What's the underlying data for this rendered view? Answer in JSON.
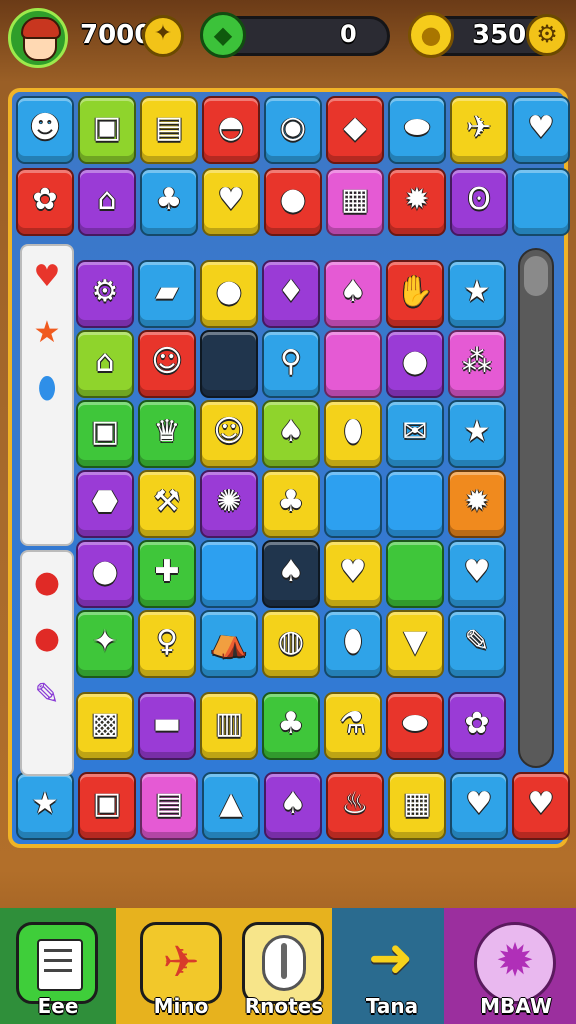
{
  "hud": {
    "score": "7000",
    "counter": "0",
    "coins": "350"
  },
  "colors": {
    "green": "#3fc63a",
    "lime": "#8fd42c",
    "yellow": "#f4d21a",
    "red": "#e8352b",
    "blue": "#2fa3e8",
    "purple": "#9a3bd6",
    "pink": "#e55ad4",
    "orange": "#f08a1e",
    "dark": "#20354d",
    "sky": "#2da0f0"
  },
  "board": {
    "rows": [
      [
        [
          "blue",
          "☻",
          "blob-creature-icon"
        ],
        [
          "lime",
          "▣",
          "monitor-icon"
        ],
        [
          "yellow",
          "▤",
          "jar-icon"
        ],
        [
          "red",
          "◓",
          "shell-icon"
        ],
        [
          "blue",
          "◉",
          "ring-icon"
        ],
        [
          "red",
          "◆",
          "leaf-icon"
        ],
        [
          "blue",
          "⬬",
          "capsule-icon"
        ],
        [
          "yellow",
          "✈",
          "plane-icon"
        ],
        [
          "blue",
          "♥",
          "heart-icon"
        ]
      ],
      [
        [
          "red",
          "✿",
          "flower-icon"
        ],
        [
          "purple",
          "⌂",
          "house-icon"
        ],
        [
          "blue",
          "♣",
          "tree-icon"
        ],
        [
          "yellow",
          "♥",
          "heart-icon"
        ],
        [
          "red",
          "●",
          "blob-icon"
        ],
        [
          "pink",
          "▦",
          "box-icon"
        ],
        [
          "red",
          "✹",
          "sun-icon"
        ],
        [
          "purple",
          "ʘ",
          "bear-face-icon"
        ],
        [
          "blue",
          "",
          "empty-tile"
        ]
      ]
    ]
  },
  "grid": [
    [
      [
        "purple",
        "⚙",
        "robot-icon"
      ],
      [
        "blue",
        "▰",
        "capsule-icon"
      ],
      [
        "yellow",
        "●",
        "bomb-icon"
      ],
      [
        "purple",
        "♦",
        "fruit-icon"
      ],
      [
        "pink",
        "♠",
        "strawberry-icon"
      ],
      [
        "red",
        "✋",
        "glove-icon"
      ],
      [
        "blue",
        "★",
        "star-icon"
      ]
    ],
    [
      [
        "lime",
        "⌂",
        "lamp-icon"
      ],
      [
        "red",
        "☺",
        "smiley-icon"
      ],
      [
        "dark",
        "",
        "empty-tile"
      ],
      [
        "blue",
        "⚲",
        "ring-icon"
      ],
      [
        "pink",
        "",
        "empty-tile"
      ],
      [
        "purple",
        "●",
        "plum-icon"
      ],
      [
        "pink",
        "⁂",
        "dots-icon"
      ]
    ],
    [
      [
        "green",
        "▣",
        "card-icon"
      ],
      [
        "green",
        "♛",
        "crown-icon"
      ],
      [
        "yellow",
        "☺",
        "cheese-icon"
      ],
      [
        "lime",
        "♠",
        "pepper-icon"
      ],
      [
        "yellow",
        "⬮",
        "lemon-icon"
      ],
      [
        "blue",
        "✉",
        "scroll-icon"
      ],
      [
        "blue",
        "★",
        "red-star-icon"
      ]
    ],
    [
      [
        "purple",
        "⬣",
        "shield-icon"
      ],
      [
        "yellow",
        "⚒",
        "hammer-icon"
      ],
      [
        "purple",
        "✺",
        "rock-icon"
      ],
      [
        "yellow",
        "♣",
        "berry-icon"
      ],
      [
        "sky",
        "",
        "empty-tile"
      ],
      [
        "sky",
        "",
        "empty-tile"
      ],
      [
        "orange",
        "✹",
        "sun-icon"
      ]
    ],
    [
      [
        "purple",
        "●",
        "lemon-icon"
      ],
      [
        "green",
        "✚",
        "plus-icon"
      ],
      [
        "sky",
        "",
        "empty-tile"
      ],
      [
        "dark",
        "♠",
        "fish-icon"
      ],
      [
        "yellow",
        "♥",
        "apple-icon"
      ],
      [
        "green",
        "",
        "empty-tile"
      ],
      [
        "blue",
        "♥",
        "heart-icon"
      ]
    ],
    [
      [
        "green",
        "✦",
        "fox-icon"
      ],
      [
        "yellow",
        "♀",
        "key-icon"
      ],
      [
        "blue",
        "⛺",
        "tent-icon"
      ],
      [
        "yellow",
        "◍",
        "pumpkin-icon"
      ],
      [
        "blue",
        "⬮",
        "pear-icon"
      ],
      [
        "yellow",
        "▼",
        "gem-icon"
      ],
      [
        "blue",
        "✎",
        "brush-icon"
      ]
    ]
  ],
  "bottomgrid": [
    [
      [
        "yellow",
        "▩",
        "cube-icon"
      ],
      [
        "purple",
        "▬",
        "bar-icon"
      ],
      [
        "yellow",
        "▥",
        "basket-icon"
      ],
      [
        "green",
        "♣",
        "leaf-icon"
      ],
      [
        "yellow",
        "⚗",
        "robot-icon"
      ],
      [
        "red",
        "⬬",
        "capsule-icon"
      ],
      [
        "purple",
        "✿",
        "flower-icon"
      ]
    ],
    [
      [
        "blue",
        "★",
        "star-icon"
      ],
      [
        "red",
        "▣",
        "sign-icon"
      ],
      [
        "pink",
        "▤",
        "card-icon"
      ],
      [
        "blue",
        "▲",
        "lamp-icon"
      ],
      [
        "purple",
        "♠",
        "fruit-icon"
      ],
      [
        "red",
        "♨",
        "fire-icon"
      ],
      [
        "yellow",
        "▦",
        "box-icon"
      ],
      [
        "blue",
        "♥",
        "apple-icon"
      ],
      [
        "red",
        "♥",
        "heart-icon"
      ]
    ]
  ],
  "side_top": [
    "♥",
    "★",
    "⬮"
  ],
  "side_bottom": [
    "●",
    "●",
    "✎"
  ],
  "bottom": {
    "b1": "Eee",
    "b2": "Mino",
    "b3": "Rnotes",
    "b4": "Tana",
    "b5": "MBAW"
  }
}
